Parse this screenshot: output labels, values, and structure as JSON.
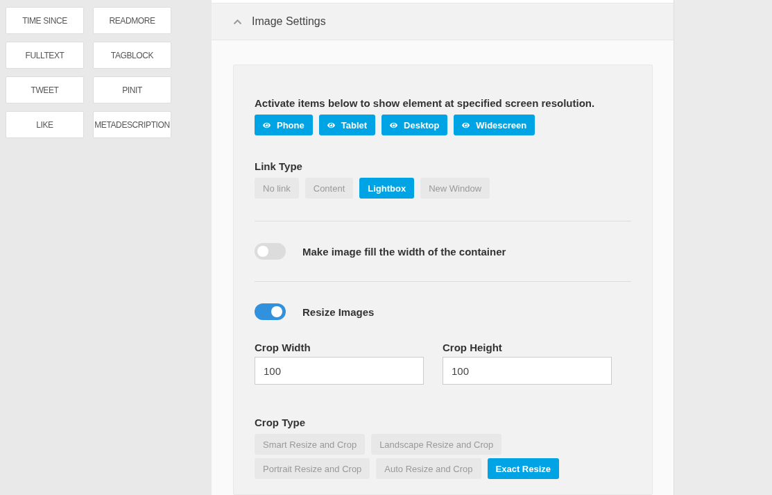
{
  "sidebar": {
    "tags": [
      "TIME SINCE",
      "READMORE",
      "FULLTEXT",
      "TAGBLOCK",
      "TWEET",
      "PINIT",
      "LIKE",
      "METADESCRIPTION"
    ]
  },
  "panel": {
    "title": "Image Settings",
    "expanded": true
  },
  "visibility": {
    "label": "Activate items below to show element at specified screen resolution.",
    "buttons": [
      {
        "label": "Phone",
        "on": true
      },
      {
        "label": "Tablet",
        "on": true
      },
      {
        "label": "Desktop",
        "on": true
      },
      {
        "label": "Widescreen",
        "on": true
      }
    ]
  },
  "link_type": {
    "label": "Link Type",
    "options": [
      {
        "label": "No link",
        "selected": false
      },
      {
        "label": "Content",
        "selected": false
      },
      {
        "label": "Lightbox",
        "selected": true
      },
      {
        "label": "New Window",
        "selected": false
      }
    ]
  },
  "toggles": [
    {
      "label": "Make image fill the width of the container",
      "on": false
    },
    {
      "label": "Resize Images",
      "on": true
    }
  ],
  "fields": [
    {
      "label": "Crop Width",
      "value": "100"
    },
    {
      "label": "Crop Height",
      "value": "100"
    }
  ],
  "crop_type": {
    "label": "Crop Type",
    "options": [
      {
        "label": "Smart Resize and Crop",
        "selected": false
      },
      {
        "label": "Landscape Resize and Crop",
        "selected": false
      },
      {
        "label": "Portrait Resize and Crop",
        "selected": false
      },
      {
        "label": "Auto Resize and Crop",
        "selected": false
      },
      {
        "label": "Exact Resize",
        "selected": true
      }
    ]
  }
}
